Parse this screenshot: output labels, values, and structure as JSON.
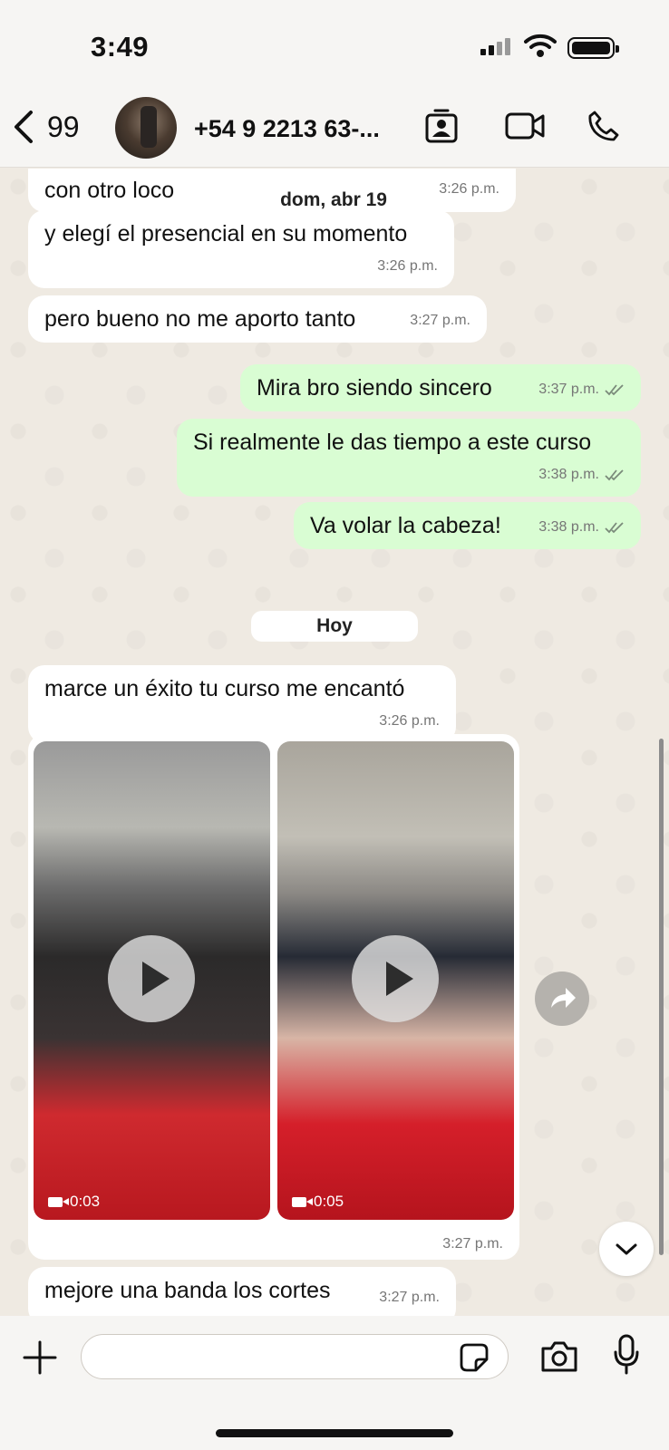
{
  "status_bar": {
    "time": "3:49"
  },
  "header": {
    "back_count": "99",
    "contact_name": "+54 9 2213 63-..."
  },
  "messages": [
    {
      "dir": "in",
      "text": "con otro loco",
      "time": "3:26 p.m."
    },
    {
      "dir": "in",
      "text": "y elegí el presencial en su momento",
      "time": "3:26 p.m."
    },
    {
      "dir": "in",
      "text": "pero bueno no me aporto tanto",
      "time": "3:27 p.m."
    },
    {
      "dir": "out",
      "text": "Mira bro siendo sincero",
      "time": "3:37 p.m."
    },
    {
      "dir": "out",
      "text": "Si realmente le das tiempo a este curso",
      "time": "3:38 p.m."
    },
    {
      "dir": "out",
      "text": "Va volar la cabeza!",
      "time": "3:38 p.m."
    },
    {
      "dir": "in",
      "text": "marce un éxito tu curso me encantó",
      "time": "3:26 p.m."
    },
    {
      "dir": "in",
      "text": "mejore una banda los cortes",
      "time": "3:27 p.m."
    }
  ],
  "date_pills": {
    "sticky": "dom, abr 19",
    "today": "Hoy"
  },
  "media_message": {
    "time": "3:27 p.m.",
    "videos": [
      {
        "duration": "0:03"
      },
      {
        "duration": "0:05"
      }
    ]
  },
  "colors": {
    "incoming": "#ffffff",
    "outgoing": "#d9fdd3",
    "background": "#efeae2",
    "ticks": "#53bdeb"
  }
}
